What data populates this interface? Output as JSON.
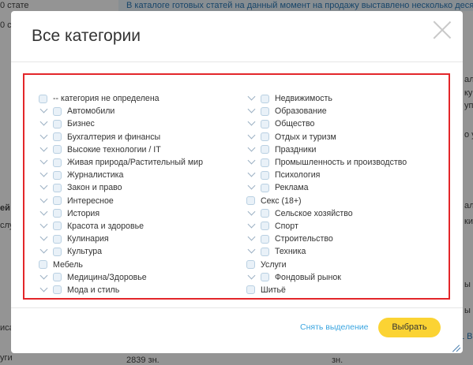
{
  "background": {
    "banner": "В каталоге готовых статей на данный момент на продажу выставлено несколько десятков тысяч статей",
    "left_texts": [
      "0 стате",
      "0 ст",
      "ей",
      "слуги",
      "иса",
      "уги"
    ],
    "right_texts": [
      "ала",
      "ку",
      "упа",
      "о уб",
      "ала 10",
      "ки",
      "ы",
      "ы",
      "1 Вол"
    ],
    "bottom_texts": [
      "2839 зн.",
      "зн."
    ]
  },
  "modal": {
    "title": "Все категории",
    "clear_label": "Снять выделение",
    "select_label": "Выбрать"
  },
  "categories": {
    "left": [
      {
        "label": "-- категория не определена",
        "expand": false
      },
      {
        "label": "Автомобили",
        "expand": true
      },
      {
        "label": "Бизнес",
        "expand": true
      },
      {
        "label": "Бухгалтерия и финансы",
        "expand": true
      },
      {
        "label": "Высокие технологии / IT",
        "expand": true
      },
      {
        "label": "Живая природа/Растительный мир",
        "expand": true
      },
      {
        "label": "Журналистика",
        "expand": true
      },
      {
        "label": "Закон и право",
        "expand": true
      },
      {
        "label": "Интересное",
        "expand": true
      },
      {
        "label": "История",
        "expand": true
      },
      {
        "label": "Красота и здоровье",
        "expand": true
      },
      {
        "label": "Кулинария",
        "expand": true
      },
      {
        "label": "Культура",
        "expand": true
      },
      {
        "label": "Мебель",
        "expand": false
      },
      {
        "label": "Медицина/Здоровье",
        "expand": true
      },
      {
        "label": "Мода и стиль",
        "expand": true
      }
    ],
    "right": [
      {
        "label": "Недвижимость",
        "expand": true
      },
      {
        "label": "Образование",
        "expand": true
      },
      {
        "label": "Общество",
        "expand": true
      },
      {
        "label": "Отдых и туризм",
        "expand": true
      },
      {
        "label": "Праздники",
        "expand": true
      },
      {
        "label": "Промышленность и производство",
        "expand": true
      },
      {
        "label": "Психология",
        "expand": true
      },
      {
        "label": "Реклама",
        "expand": true
      },
      {
        "label": "Секс (18+)",
        "expand": false
      },
      {
        "label": "Сельское хозяйство",
        "expand": true
      },
      {
        "label": "Спорт",
        "expand": true
      },
      {
        "label": "Строительство",
        "expand": true
      },
      {
        "label": "Техника",
        "expand": true
      },
      {
        "label": "Услуги",
        "expand": false
      },
      {
        "label": "Фондовый рынок",
        "expand": true
      },
      {
        "label": "Шитьё",
        "expand": false
      }
    ]
  },
  "colors": {
    "highlight_border": "#e3262a",
    "primary_button": "#fbd333",
    "link": "#3aa5e0"
  }
}
